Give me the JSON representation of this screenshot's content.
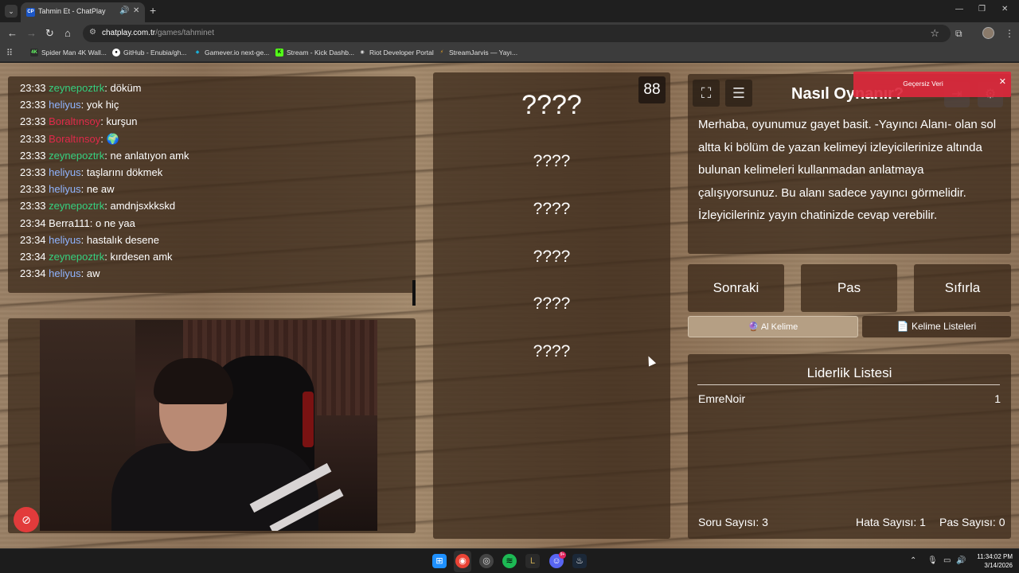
{
  "browser": {
    "tab_favicon": "CP",
    "tab_title": "Tahmin Et - ChatPlay",
    "url_host": "chatplay.com.tr",
    "url_path": "/games/tahminet",
    "bookmarks": [
      {
        "label": "Spider Man 4K Wall...",
        "icon_text": "4K",
        "color": "#2b2b2b"
      },
      {
        "label": "GitHub - Enubia/gh...",
        "icon_text": "●",
        "color": "#ffffff"
      },
      {
        "label": "Gamever.io next-ge...",
        "icon_text": "◆",
        "color": "#1ab0d8"
      },
      {
        "label": "Stream - Kick Dashb...",
        "icon_text": "K",
        "color": "#53fc18"
      },
      {
        "label": "Riot Developer Portal",
        "icon_text": "◉",
        "color": "#d0d0d0"
      },
      {
        "label": "StreamJarvis — Yayı...",
        "icon_text": "⚡",
        "color": "#ffb020"
      }
    ]
  },
  "chat": {
    "messages": [
      {
        "time": "23:33",
        "user": "zeynepoztrk",
        "color": "#35d07f",
        "text": ": döküm"
      },
      {
        "time": "23:33",
        "user": "heliyus",
        "color": "#8fb4ff",
        "text": ": yok hiç"
      },
      {
        "time": "23:33",
        "user": "Boraltınsoy",
        "color": "#e0294a",
        "text": ": kurşun"
      },
      {
        "time": "23:33",
        "user": "Boraltınsoy",
        "color": "#e0294a",
        "text": ": 🌍"
      },
      {
        "time": "23:33",
        "user": "zeynepoztrk",
        "color": "#35d07f",
        "text": ": ne anlatıyon amk"
      },
      {
        "time": "23:33",
        "user": "heliyus",
        "color": "#8fb4ff",
        "text": ": taşlarını dökmek"
      },
      {
        "time": "23:33",
        "user": "heliyus",
        "color": "#8fb4ff",
        "text": ": ne aw"
      },
      {
        "time": "23:33",
        "user": "zeynepoztrk",
        "color": "#35d07f",
        "text": ": amdnjsxkkskd"
      },
      {
        "time": "23:34",
        "user": "Berra111",
        "color": "#ffffff",
        "text": ": o ne yaa"
      },
      {
        "time": "23:34",
        "user": "heliyus",
        "color": "#8fb4ff",
        "text": ": hastalık desene"
      },
      {
        "time": "23:34",
        "user": "zeynepoztrk",
        "color": "#35d07f",
        "text": ": kırdesen amk"
      },
      {
        "time": "23:34",
        "user": "heliyus",
        "color": "#8fb4ff",
        "text": ": aw"
      }
    ]
  },
  "game": {
    "timer": "88",
    "main_word": "????",
    "taboo_words": [
      "????",
      "????",
      "????",
      "????",
      "????"
    ]
  },
  "help": {
    "title": "Nasıl Oynanır?",
    "body": "Merhaba, oyunumuz gayet basit. -Yayıncı Alanı- olan sol altta ki bölüm de yazan kelimeyi izleyicilerinize altında bulunan kelimeleri kullanmadan anlatmaya çalışıyorsunuz. Bu alanı sadece yayıncı görmelidir. İzleyicileriniz yayın chatinizde cevap verebilir.",
    "toast": "Geçersiz Veri"
  },
  "actions": {
    "next": "Sonraki",
    "pass": "Pas",
    "reset": "Sıfırla",
    "get_word": "Al Kelime",
    "word_lists": "Kelime Listeleri"
  },
  "leaderboard": {
    "title": "Liderlik Listesi",
    "rows": [
      {
        "name": "EmreNoir",
        "score": "1"
      }
    ],
    "question_count": "Soru Sayısı: 3",
    "error_count": "Hata Sayısı: 1",
    "pass_count": "Pas Sayısı: 0"
  },
  "taskbar": {
    "time": "11:34:02 PM",
    "date": "3/14/2026",
    "discord_badge": "9+"
  }
}
